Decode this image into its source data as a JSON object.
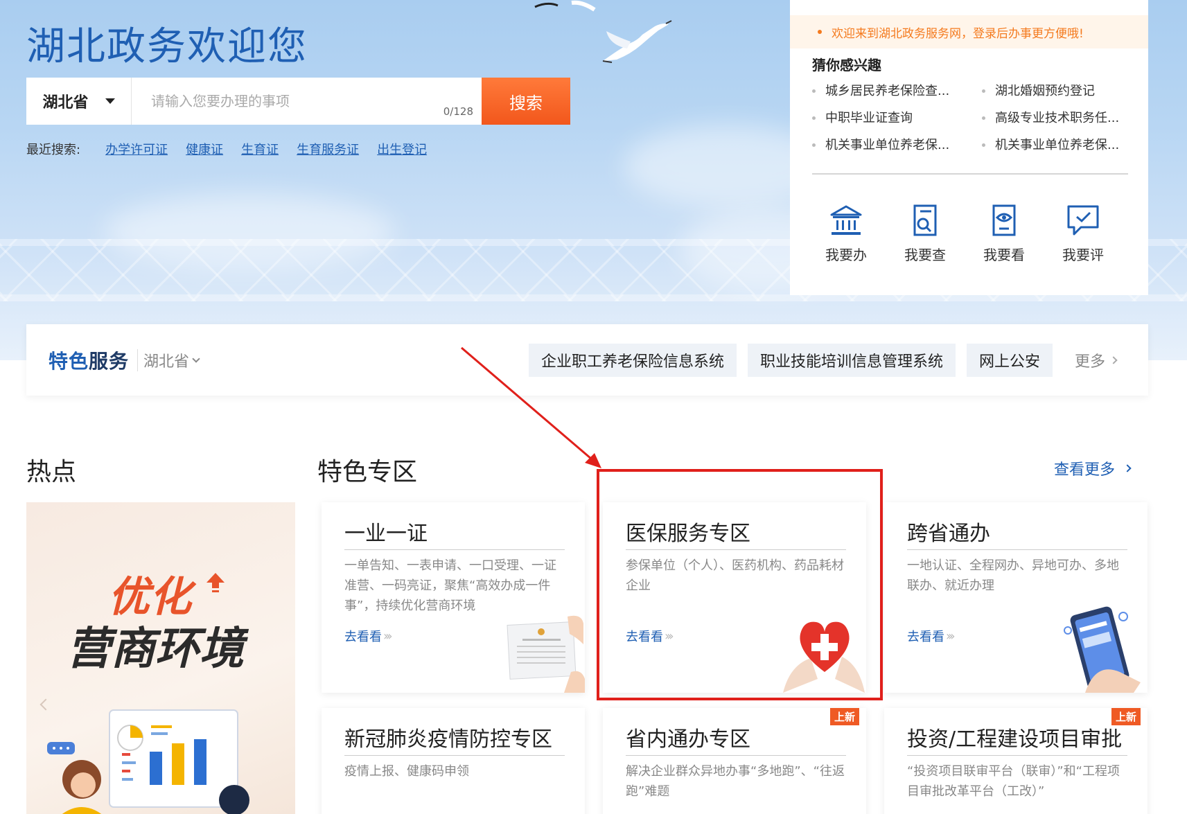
{
  "header": {
    "welcome_title": "湖北政务欢迎您"
  },
  "search": {
    "region": "湖北省",
    "placeholder": "请输入您要办理的事项",
    "char_count": "0/128",
    "button_label": "搜索"
  },
  "recent": {
    "label": "最近搜索:",
    "items": [
      "办学许可证",
      "健康证",
      "生育证",
      "生育服务证",
      "出生登记"
    ]
  },
  "side_panel": {
    "notice": "欢迎来到湖北政务服务网，登录后办事更方便哦!",
    "interest_title": "猜你感兴趣",
    "interests": [
      "城乡居民养老保险查...",
      "湖北婚姻预约登记",
      "中职毕业证查询",
      "高级专业技术职务任...",
      "机关事业单位养老保...",
      "机关事业单位养老保..."
    ],
    "quick_actions": [
      {
        "label": "我要办",
        "icon": "bank-icon"
      },
      {
        "label": "我要查",
        "icon": "search-doc-icon"
      },
      {
        "label": "我要看",
        "icon": "view-doc-icon"
      },
      {
        "label": "我要评",
        "icon": "comment-check-icon"
      }
    ]
  },
  "feature_bar": {
    "brand_part1": "特色",
    "brand_part2": "服务",
    "region": "湖北省",
    "links": [
      "企业职工养老保险信息系统",
      "职业技能培训信息管理系统",
      "网上公安"
    ],
    "more": "更多"
  },
  "sections": {
    "hot_title": "热点",
    "zone_title": "特色专区",
    "view_more": "查看更多"
  },
  "hot_banner": {
    "line1": "优化",
    "line2": "营商环境"
  },
  "cards": [
    {
      "title": "一业一证",
      "desc": "一单告知、一表申请、一口受理、一证准营、一码亮证，聚焦“高效办成一件事”，持续优化营商环境",
      "link": "去看看",
      "badge": ""
    },
    {
      "title": "医保服务专区",
      "desc": "参保单位（个人）、医药机构、药品耗材企业",
      "link": "去看看",
      "badge": ""
    },
    {
      "title": "跨省通办",
      "desc": "一地认证、全程网办、异地可办、多地联办、就近办理",
      "link": "去看看",
      "badge": ""
    },
    {
      "title": "新冠肺炎疫情防控专区",
      "desc": "疫情上报、健康码申领",
      "link": "",
      "badge": ""
    },
    {
      "title": "省内通办专区",
      "desc": "解决企业群众异地办事“多地跑”、“往返跑”难题",
      "link": "",
      "badge": "上新"
    },
    {
      "title": "投资/工程建设项目审批",
      "desc": "“投资项目联审平台（联审）”和“工程项目审批改革平台（工改）”",
      "link": "",
      "badge": "上新"
    }
  ],
  "colors": {
    "brand_blue": "#1f5fb3",
    "search_orange": "#f2571c",
    "notice_orange": "#f47a1e",
    "highlight_red": "#e0201b"
  }
}
